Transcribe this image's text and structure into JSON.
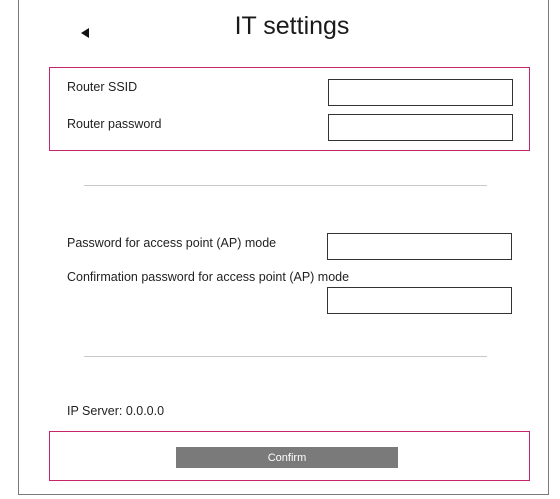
{
  "header": {
    "title": "IT settings",
    "back_icon": "back-arrow-icon"
  },
  "router": {
    "ssid_label": "Router SSID",
    "ssid_value": "",
    "password_label": "Router password",
    "password_value": ""
  },
  "access_point": {
    "password_label": "Password for access point (AP) mode",
    "password_value": "",
    "confirm_label": "Confirmation password for access point (AP) mode",
    "confirm_value": ""
  },
  "status": {
    "ip_server_text": "IP Server: 0.0.0.0"
  },
  "actions": {
    "confirm_label": "Confirm"
  },
  "colors": {
    "section_border": "#c5256a",
    "button_bg": "#7a7a7a",
    "divider": "#c8c8c8"
  }
}
